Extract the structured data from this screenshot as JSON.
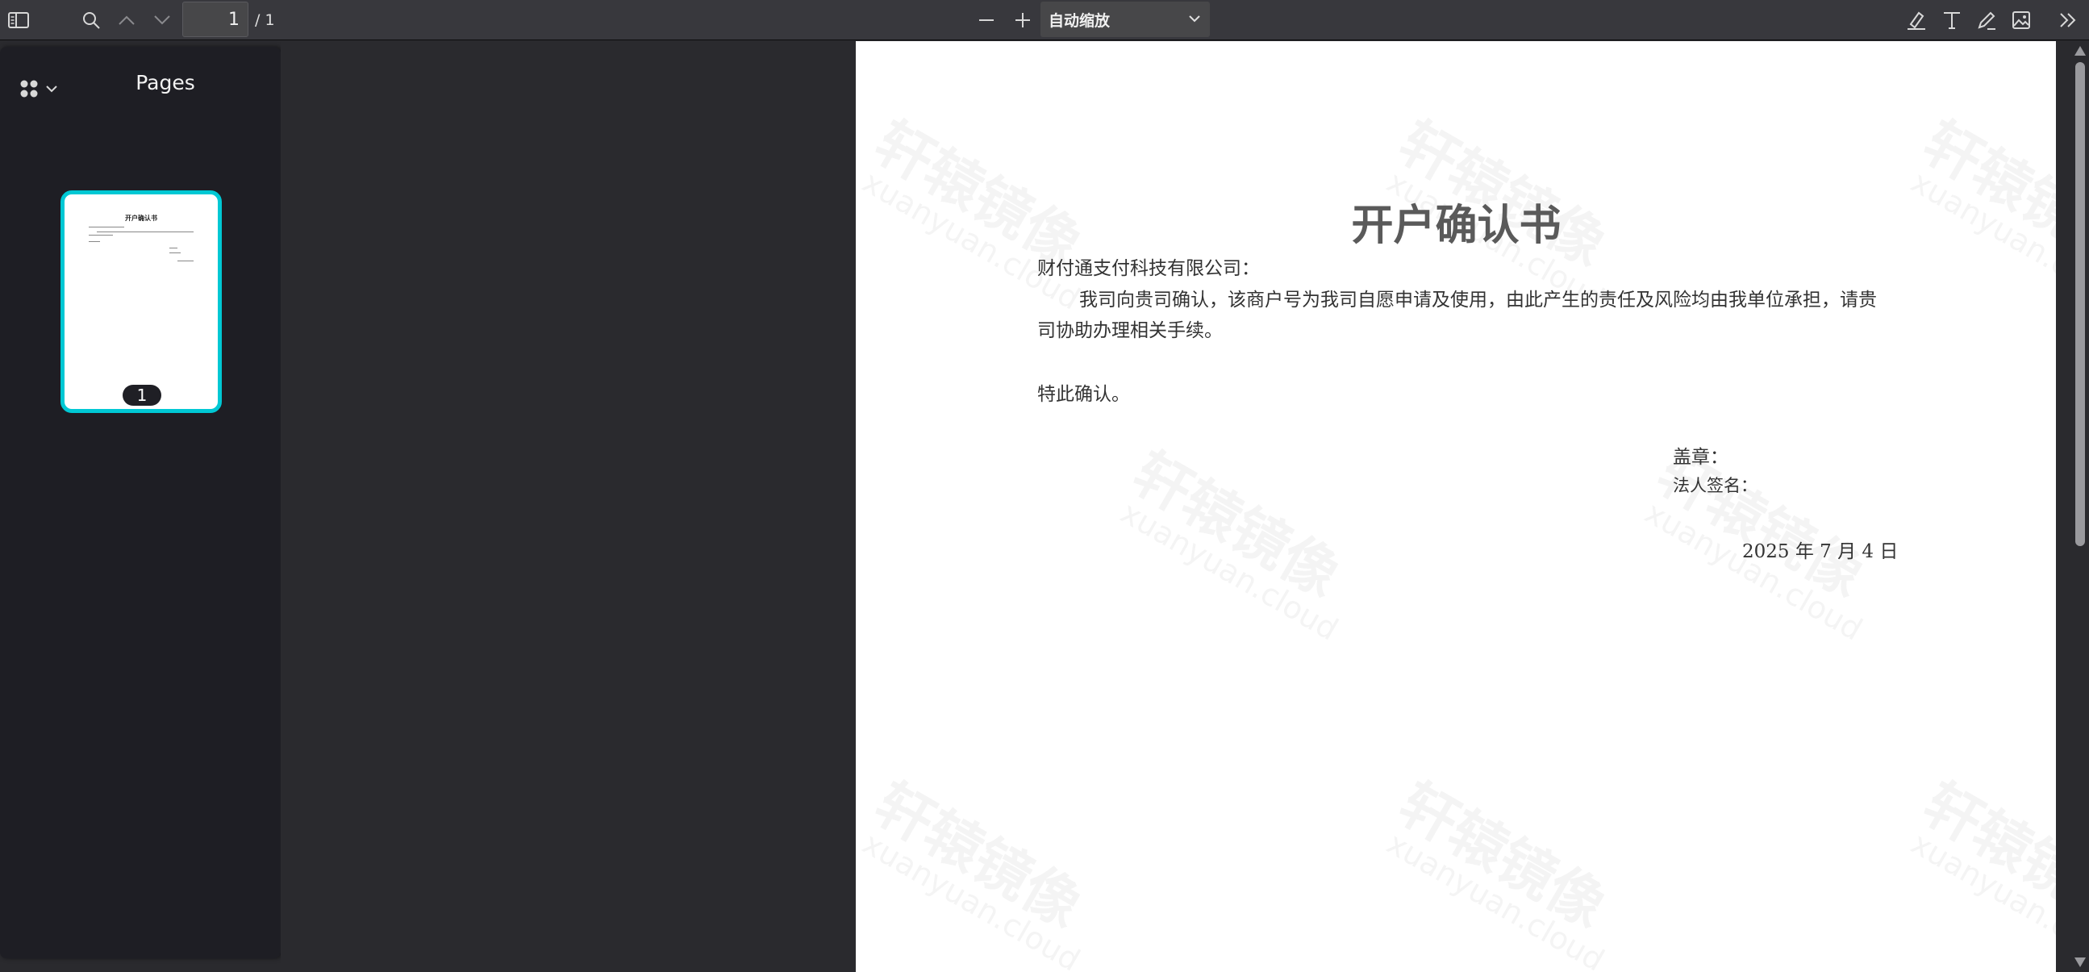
{
  "toolbar": {
    "page_number": "1",
    "page_count": "/ 1",
    "zoom_label": "自动缩放"
  },
  "sidebar": {
    "title": "Pages",
    "thumbnail": {
      "page_label": "1",
      "title": "开户确认书"
    }
  },
  "document": {
    "title": "开户确认书",
    "addressee": "财付通支付科技有限公司：",
    "body_line1": "我司向贵司确认，该商户号为我司自愿申请及使用，由此产生的责任及风险均由我单位承担，请贵",
    "body_line2": "司协助办理相关手续。",
    "confirm": "特此确认。",
    "seal_label": "盖章：",
    "signature_label": "法人签名：",
    "date": "2025 年 7 月 4 日",
    "watermark_zh": "轩辕镜像",
    "watermark_en": "xuanyuan.cloud"
  },
  "colors": {
    "toolbar_bg": "#38383d",
    "sidebar_bg": "#1e1e24",
    "thumbnail_border": "#00c8d4",
    "page_bg": "#ffffff"
  },
  "icons": [
    "sidebar-toggle-icon",
    "search-icon",
    "chevron-up-icon",
    "chevron-down-icon",
    "minus-icon",
    "plus-icon",
    "highlight-icon",
    "text-icon",
    "draw-icon",
    "image-icon",
    "double-chevron-right-icon",
    "grid-icon"
  ]
}
